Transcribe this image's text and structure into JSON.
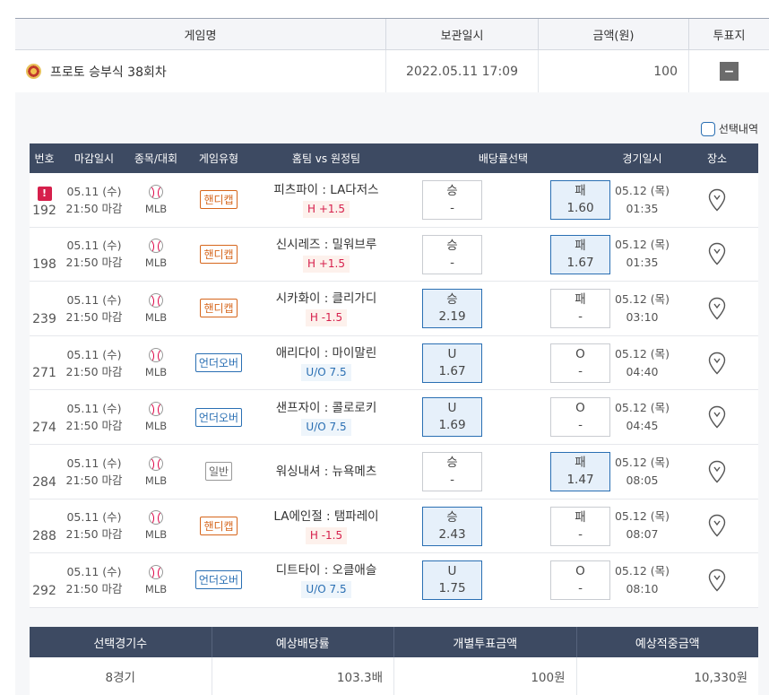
{
  "top_table": {
    "headers": {
      "game_name": "게임명",
      "stored_at": "보관일시",
      "amount": "금액(원)",
      "vote": "투표지"
    },
    "row": {
      "game_name": "프로토 승부식 38회차",
      "stored_at": "2022.05.11 17:09",
      "amount": "100",
      "vote_button": "−"
    }
  },
  "selection_history_label": "선택내역",
  "detail_headers": {
    "number": "번호",
    "deadline": "마감일시",
    "sport": "종목/대회",
    "game_type": "게임유형",
    "teams": "홈팀 vs 원정팀",
    "odds": "배당률선택",
    "match_time": "경기일시",
    "venue": "장소"
  },
  "rows": [
    {
      "num": "192",
      "alert": "!",
      "deadline_date": "05.11 (수)",
      "deadline_time": "21:50 마감",
      "league": "MLB",
      "type": "핸디캡",
      "type_class": "hc",
      "teams": "피츠파이 : LA다저스",
      "tag": "H +1.5",
      "tag_class": "h",
      "left_label": "승",
      "left_value": "-",
      "left_sel": false,
      "right_label": "패",
      "right_value": "1.60",
      "right_sel": true,
      "match_date": "05.12 (목)",
      "match_time": "01:35"
    },
    {
      "num": "198",
      "alert": "",
      "deadline_date": "05.11 (수)",
      "deadline_time": "21:50 마감",
      "league": "MLB",
      "type": "핸디캡",
      "type_class": "hc",
      "teams": "신시레즈 : 밀워브루",
      "tag": "H +1.5",
      "tag_class": "h",
      "left_label": "승",
      "left_value": "-",
      "left_sel": false,
      "right_label": "패",
      "right_value": "1.67",
      "right_sel": true,
      "match_date": "05.12 (목)",
      "match_time": "01:35"
    },
    {
      "num": "239",
      "alert": "",
      "deadline_date": "05.11 (수)",
      "deadline_time": "21:50 마감",
      "league": "MLB",
      "type": "핸디캡",
      "type_class": "hc",
      "teams": "시카화이 : 클리가디",
      "tag": "H -1.5",
      "tag_class": "h",
      "left_label": "승",
      "left_value": "2.19",
      "left_sel": true,
      "right_label": "패",
      "right_value": "-",
      "right_sel": false,
      "match_date": "05.12 (목)",
      "match_time": "03:10"
    },
    {
      "num": "271",
      "alert": "",
      "deadline_date": "05.11 (수)",
      "deadline_time": "21:50 마감",
      "league": "MLB",
      "type": "언더오버",
      "type_class": "uo",
      "teams": "애리다이 : 마이말린",
      "tag": "U/O 7.5",
      "tag_class": "u",
      "left_label": "U",
      "left_value": "1.67",
      "left_sel": true,
      "right_label": "O",
      "right_value": "-",
      "right_sel": false,
      "match_date": "05.12 (목)",
      "match_time": "04:40"
    },
    {
      "num": "274",
      "alert": "",
      "deadline_date": "05.11 (수)",
      "deadline_time": "21:50 마감",
      "league": "MLB",
      "type": "언더오버",
      "type_class": "uo",
      "teams": "샌프자이 : 콜로로키",
      "tag": "U/O 7.5",
      "tag_class": "u",
      "left_label": "U",
      "left_value": "1.69",
      "left_sel": true,
      "right_label": "O",
      "right_value": "-",
      "right_sel": false,
      "match_date": "05.12 (목)",
      "match_time": "04:45"
    },
    {
      "num": "284",
      "alert": "",
      "deadline_date": "05.11 (수)",
      "deadline_time": "21:50 마감",
      "league": "MLB",
      "type": "일반",
      "type_class": "gen",
      "teams": "워싱내셔 : 뉴욕메츠",
      "tag": "",
      "tag_class": "",
      "left_label": "승",
      "left_value": "-",
      "left_sel": false,
      "right_label": "패",
      "right_value": "1.47",
      "right_sel": true,
      "match_date": "05.12 (목)",
      "match_time": "08:05"
    },
    {
      "num": "288",
      "alert": "",
      "deadline_date": "05.11 (수)",
      "deadline_time": "21:50 마감",
      "league": "MLB",
      "type": "핸디캡",
      "type_class": "hc",
      "teams": "LA에인절 : 탬파레이",
      "tag": "H -1.5",
      "tag_class": "h",
      "left_label": "승",
      "left_value": "2.43",
      "left_sel": true,
      "right_label": "패",
      "right_value": "-",
      "right_sel": false,
      "match_date": "05.12 (목)",
      "match_time": "08:07"
    },
    {
      "num": "292",
      "alert": "",
      "deadline_date": "05.11 (수)",
      "deadline_time": "21:50 마감",
      "league": "MLB",
      "type": "언더오버",
      "type_class": "uo",
      "teams": "디트타이 : 오클애슬",
      "tag": "U/O 7.5",
      "tag_class": "u",
      "left_label": "U",
      "left_value": "1.75",
      "left_sel": true,
      "right_label": "O",
      "right_value": "-",
      "right_sel": false,
      "match_date": "05.12 (목)",
      "match_time": "08:10"
    }
  ],
  "summary": {
    "headers": [
      "선택경기수",
      "예상배당률",
      "개별투표금액",
      "예상적중금액"
    ],
    "values": [
      "8경기",
      "103.3배",
      "100원",
      "10,330원"
    ]
  },
  "colors": {
    "header_bg": "#3d4a62",
    "selected_odds_bg": "#e6f0fa",
    "handicap": "#d6661c",
    "under_over": "#2a6fb3",
    "alert": "#d6204c"
  }
}
